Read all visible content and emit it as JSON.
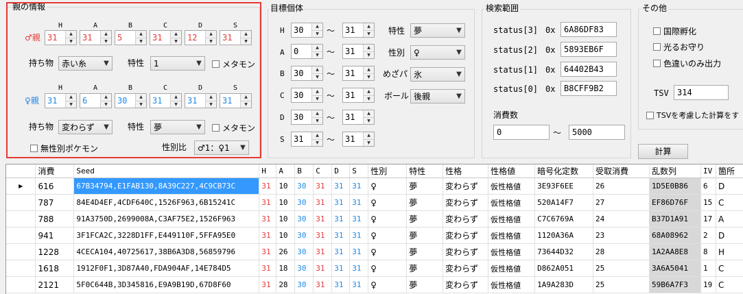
{
  "parent_group": {
    "title": "親の情報",
    "stat_headers": [
      "H",
      "A",
      "B",
      "C",
      "D",
      "S"
    ],
    "male": {
      "label": "♂親",
      "ivs": [
        "31",
        "31",
        "5",
        "31",
        "12",
        "31"
      ],
      "item_label": "持ち物",
      "item_value": "赤い糸",
      "ability_label": "特性",
      "ability_value": "1",
      "ditto_label": "メタモン"
    },
    "female": {
      "label": "♀親",
      "ivs": [
        "31",
        "6",
        "30",
        "31",
        "31",
        "31"
      ],
      "item_label": "持ち物",
      "item_value": "変わらず",
      "ability_label": "特性",
      "ability_value": "夢",
      "ditto_label": "メタモン"
    },
    "genderless_label": "無性別ポケモン",
    "ratio_label": "性別比",
    "ratio_value": "♂1：♀1"
  },
  "target_group": {
    "title": "目標個体",
    "rows": [
      {
        "stat": "H",
        "min": "30",
        "max": "31"
      },
      {
        "stat": "A",
        "min": "0",
        "max": "31"
      },
      {
        "stat": "B",
        "min": "30",
        "max": "31"
      },
      {
        "stat": "C",
        "min": "30",
        "max": "31"
      },
      {
        "stat": "D",
        "min": "30",
        "max": "31"
      },
      {
        "stat": "S",
        "min": "31",
        "max": "31"
      }
    ],
    "tilde": "～",
    "ability_label": "特性",
    "ability_value": "夢",
    "gender_label": "性別",
    "gender_value": "♀",
    "hp_label": "めざパ",
    "hp_value": "氷",
    "ball_label": "ボール",
    "ball_value": "後親"
  },
  "search_group": {
    "title": "検索範囲",
    "status": [
      {
        "label": "status[3]",
        "prefix": "0x",
        "value": "6A86DF83"
      },
      {
        "label": "status[2]",
        "prefix": "0x",
        "value": "5893EB6F"
      },
      {
        "label": "status[1]",
        "prefix": "0x",
        "value": "64402B43"
      },
      {
        "label": "status[0]",
        "prefix": "0x",
        "value": "B8CFF9B2"
      }
    ],
    "consume_label": "消費数",
    "consume_min": "0",
    "consume_tilde": "～",
    "consume_max": "5000"
  },
  "other_group": {
    "title": "その他",
    "intl_label": "国際孵化",
    "charm_label": "光るお守り",
    "shiny_label": "色違いのみ出力",
    "tsv_label": "TSV",
    "tsv_value": "314",
    "tsv_check_label": "TSVを考慮した計算をす"
  },
  "calc_button": "計算",
  "table": {
    "columns": [
      "消費",
      "Seed",
      "H",
      "A",
      "B",
      "C",
      "D",
      "S",
      "性別",
      "特性",
      "性格",
      "性格値",
      "暗号化定数",
      "受取消費",
      "乱数列",
      "IV",
      "箇所"
    ],
    "rows": [
      [
        "616",
        "67B34794,E1FAB130,8A39C227,4C9CB73C",
        "31",
        "10",
        "30",
        "31",
        "31",
        "31",
        "♀",
        "夢",
        "変わらず",
        "仮性格値",
        "3E93F6EE",
        "26",
        "1D5E0B86",
        "6",
        "D"
      ],
      [
        "787",
        "84E4D4EF,4CDF640C,1526F963,6B15241C",
        "31",
        "10",
        "30",
        "31",
        "31",
        "31",
        "♀",
        "夢",
        "変わらず",
        "仮性格値",
        "520A14F7",
        "27",
        "EF86D76F",
        "15",
        "C"
      ],
      [
        "788",
        "91A3750D,2699008A,C3AF75E2,1526F963",
        "31",
        "10",
        "30",
        "31",
        "31",
        "31",
        "♀",
        "夢",
        "変わらず",
        "仮性格値",
        "C7C6769A",
        "24",
        "B37D1A91",
        "17",
        "A"
      ],
      [
        "941",
        "3F1FCA2C,3228D1FF,E449110F,5FFA95E0",
        "31",
        "10",
        "30",
        "31",
        "31",
        "31",
        "♀",
        "夢",
        "変わらず",
        "仮性格値",
        "1120A36A",
        "23",
        "68A08962",
        "2",
        "D"
      ],
      [
        "1228",
        "4CECA104,40725617,38B6A3D8,56859796",
        "31",
        "26",
        "30",
        "31",
        "31",
        "31",
        "♀",
        "夢",
        "変わらず",
        "仮性格値",
        "73644D32",
        "28",
        "1A2AA8E8",
        "8",
        "H"
      ],
      [
        "1618",
        "1912F0F1,3D87A40,FDA904AF,14E784D5",
        "31",
        "18",
        "30",
        "31",
        "31",
        "31",
        "♀",
        "夢",
        "変わらず",
        "仮性格値",
        "D862A051",
        "25",
        "3A6A5041",
        "1",
        "C"
      ],
      [
        "2121",
        "5F0C644B,3D345816,E9A9B19D,67D8F60",
        "31",
        "28",
        "30",
        "31",
        "31",
        "31",
        "♀",
        "夢",
        "変わらず",
        "仮性格値",
        "1A9A283D",
        "25",
        "59B6A7F3",
        "19",
        "C"
      ]
    ],
    "row_colors": {
      "2": [
        "red",
        "",
        "blue",
        "red",
        "blue",
        "blue"
      ]
    }
  },
  "colors": {
    "red": "#e53935",
    "blue": "#1e88e5",
    "selected": "#3399ff"
  }
}
